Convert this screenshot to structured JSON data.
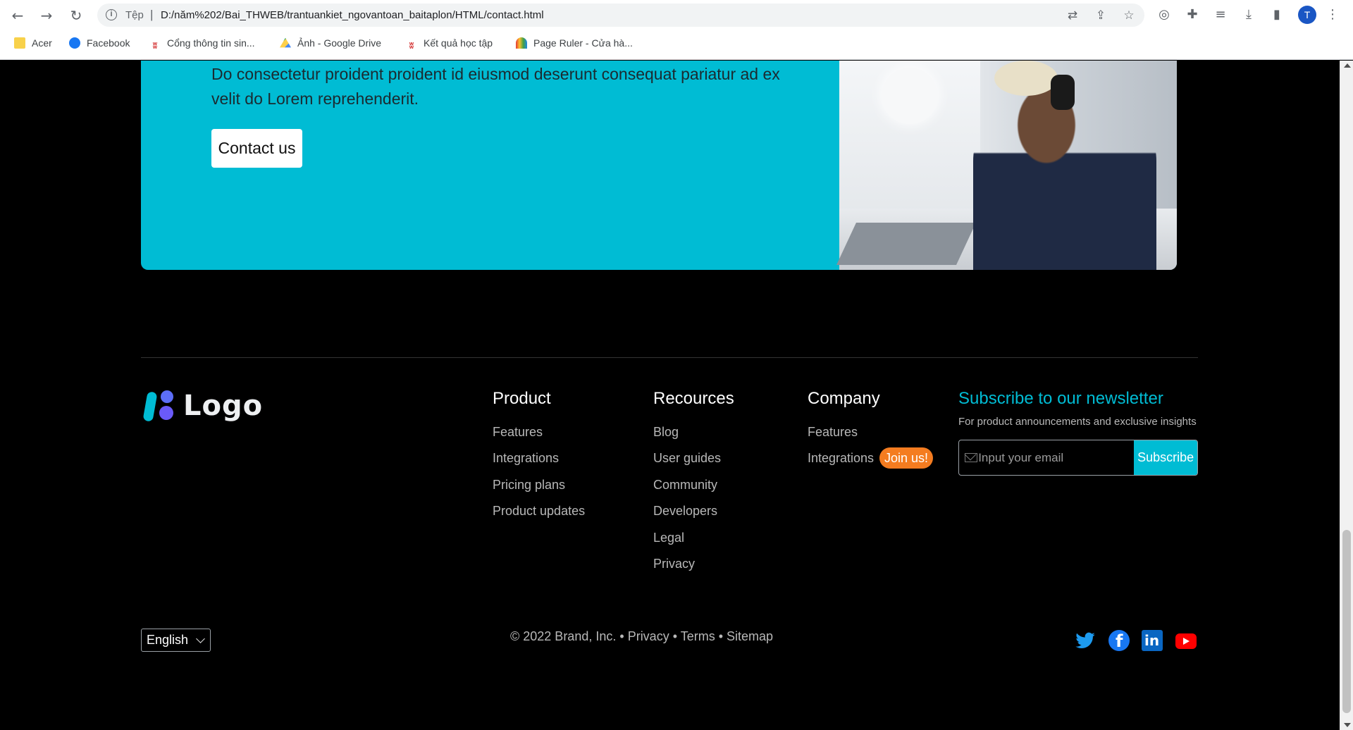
{
  "browser": {
    "scheme_label": "Tệp",
    "url": "D:/năm%202/Bai_THWEB/trantuankiet_ngovantoan_baitaplon/HTML/contact.html",
    "avatar_initial": "T",
    "bookmarks": [
      {
        "label": "Acer",
        "icon": "folder-icon"
      },
      {
        "label": "Facebook",
        "icon": "facebook-icon"
      },
      {
        "label": "Cổng thông tin sin...",
        "icon": "school-logo-icon"
      },
      {
        "label": "Ảnh - Google Drive",
        "icon": "google-drive-icon"
      },
      {
        "label": "Kết quả học tập",
        "icon": "school-logo-icon"
      },
      {
        "label": "Page Ruler - Cửa hà...",
        "icon": "chrome-webstore-icon"
      }
    ]
  },
  "cta": {
    "text": "Do consectetur proident proident id eiusmod deserunt consequat pariatur ad ex velit do Lorem reprehenderit.",
    "button_label": "Contact us",
    "background": "#00bcd4"
  },
  "footer": {
    "logo_text": "Logo",
    "columns": [
      {
        "title": "Product",
        "links": [
          "Features",
          "Integrations",
          "Pricing plans",
          "Product updates"
        ]
      },
      {
        "title": "Recources",
        "links": [
          "Blog",
          "User guides",
          "Community",
          "Developers",
          "Legal",
          "Privacy"
        ]
      },
      {
        "title": "Company",
        "links": [
          "Features",
          "Integrations"
        ]
      }
    ],
    "join_badge": "Join us!",
    "newsletter": {
      "title": "Subscribe to our newsletter",
      "subtitle": "For product announcements and exclusive insights",
      "placeholder": "Input your email",
      "button_label": "Subscribe"
    },
    "language": "English",
    "copyright": "© 2022 Brand, Inc.",
    "legal_links": [
      "Privacy",
      "Terms",
      "Sitemap"
    ],
    "social": [
      "twitter-icon",
      "facebook-icon",
      "linkedin-icon",
      "youtube-icon"
    ],
    "colors": {
      "accent": "#00bcd4",
      "badge": "#f47c20"
    }
  }
}
